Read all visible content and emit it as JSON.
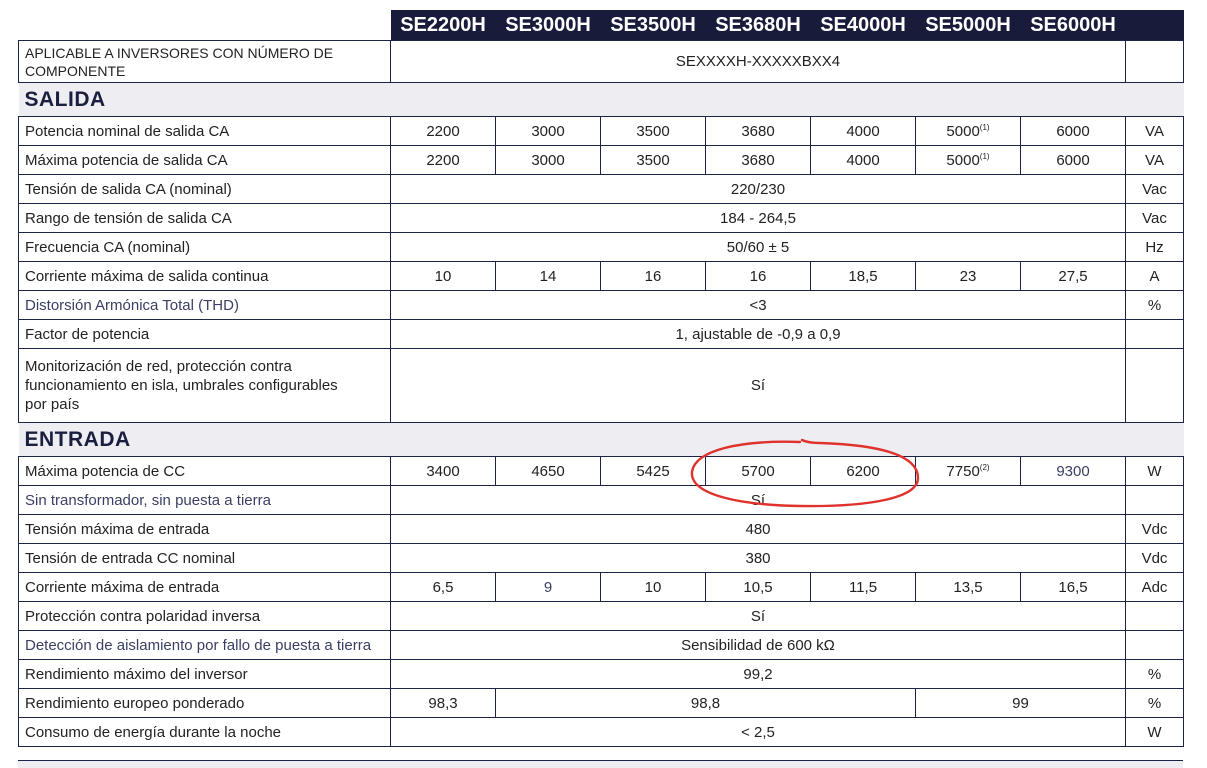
{
  "models": [
    "SE2200H",
    "SE3000H",
    "SE3500H",
    "SE3680H",
    "SE4000H",
    "SE5000H",
    "SE6000H"
  ],
  "applicable": {
    "label": "APLICABLE A INVERSORES CON NÚMERO DE COMPONENTE",
    "value": "SEXXXXH-XXXXXBXX4",
    "unit": ""
  },
  "sections": [
    {
      "title": "SALIDA",
      "rows": [
        {
          "label": "Potencia nominal de salida CA",
          "cells": [
            "2200",
            "3000",
            "3500",
            "3680",
            "4000",
            "5000",
            "6000"
          ],
          "sups": [
            "",
            "",
            "",
            "",
            "",
            "(1)",
            ""
          ],
          "unit": "VA"
        },
        {
          "label": "Máxima potencia de salida CA",
          "cells": [
            "2200",
            "3000",
            "3500",
            "3680",
            "4000",
            "5000",
            "6000"
          ],
          "sups": [
            "",
            "",
            "",
            "",
            "",
            "(1)",
            ""
          ],
          "unit": "VA"
        },
        {
          "label": "Tensión de salida CA (nominal)",
          "span": "220/230",
          "unit": "Vac"
        },
        {
          "label": "Rango de tensión de salida CA",
          "span": "184 - 264,5",
          "unit": "Vac"
        },
        {
          "label": "Frecuencia CA (nominal)",
          "span": "50/60 ± 5",
          "unit": "Hz"
        },
        {
          "label": "Corriente máxima de salida continua",
          "cells": [
            "10",
            "14",
            "16",
            "16",
            "18,5",
            "23",
            "27,5"
          ],
          "unit": "A"
        },
        {
          "label": "Distorsión Armónica Total (THD)",
          "span": "<3",
          "unit": "%"
        },
        {
          "label": "Factor de potencia",
          "span": "1, ajustable de -0,9 a 0,9",
          "unit": ""
        },
        {
          "label": "Monitorización de red, protección contra funcionamiento en isla, umbrales configurables por país",
          "span": "Sí",
          "unit": ""
        }
      ]
    },
    {
      "title": "ENTRADA",
      "rows": [
        {
          "label": "Máxima potencia de CC",
          "cells": [
            "3400",
            "4650",
            "5425",
            "5700",
            "6200",
            "7750",
            "9300"
          ],
          "sups": [
            "",
            "",
            "",
            "",
            "",
            "(2)",
            ""
          ],
          "unit": "W"
        },
        {
          "label": "Sin transformador, sin puesta a tierra",
          "span": "Sí",
          "unit": ""
        },
        {
          "label": "Tensión máxima de entrada",
          "span": "480",
          "unit": "Vdc"
        },
        {
          "label": "Tensión de entrada CC nominal",
          "span": "380",
          "unit": "Vdc"
        },
        {
          "label": "Corriente máxima de entrada",
          "cells": [
            "6,5",
            "9",
            "10",
            "10,5",
            "11,5",
            "13,5",
            "16,5"
          ],
          "unit": "Adc"
        },
        {
          "label": "Protección contra polaridad inversa",
          "span": "Sí",
          "unit": ""
        },
        {
          "label": "Detección de aislamiento por fallo de puesta a tierra",
          "span": "Sensibilidad de 600 kΩ",
          "unit": ""
        },
        {
          "label": "Rendimiento máximo del inversor",
          "span": "99,2",
          "unit": "%"
        },
        {
          "label": "Rendimiento europeo ponderado",
          "groups": [
            "98,3",
            "98,8",
            "99"
          ],
          "unit": "%"
        },
        {
          "label": "Consumo de energía durante la noche",
          "span": "< 2,5",
          "unit": "W"
        }
      ]
    }
  ],
  "colors": {
    "header_bg": "#181c3a",
    "section_bg": "#eeeef2",
    "border": "#1d2247",
    "annotation": "#e0322d"
  }
}
